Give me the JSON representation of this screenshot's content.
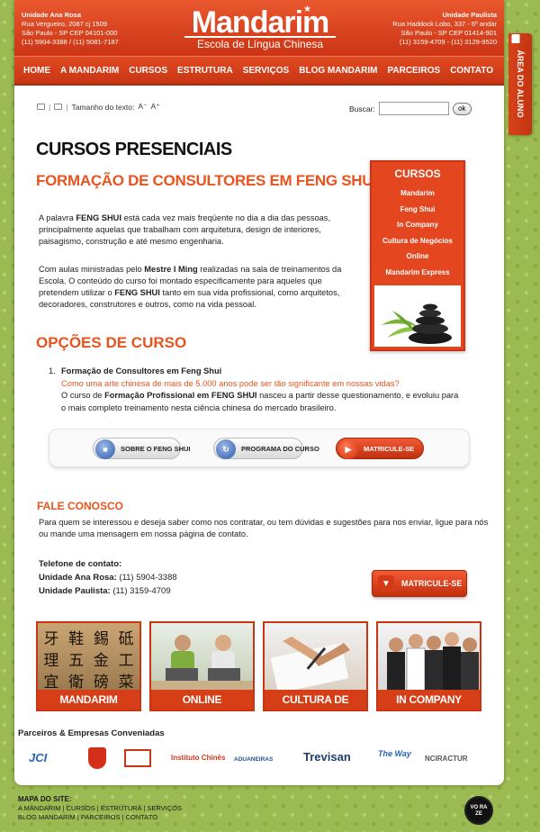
{
  "header": {
    "left": {
      "name": "Unidade Ana Rosa",
      "address1": "Rua Vergueiro, 2087 cj 1509",
      "address2": "São Paulo - SP CEP 04101-000",
      "phones": "(11) 5904-3388 / (11) 5081-7187"
    },
    "right": {
      "name": "Unidade Paulista",
      "address1": "Rua Haddock Lobo, 337 - 6º andar",
      "address2": "São Paulo - SP CEP 01414-901",
      "phones": "(11) 3159-4709 - (11) 3129-9520"
    },
    "logo": {
      "main": "Mandarim",
      "sub": "Escola de Língua Chinesa"
    }
  },
  "nav": [
    "HOME",
    "A MANDARIM",
    "CURSOS",
    "ESTRUTURA",
    "SERVIÇOS",
    "BLOG MANDARIM",
    "PARCEIROS",
    "CONTATO"
  ],
  "student_tab": "ÁREA DO ALUNO",
  "tools": {
    "text_size_label": "Tamanho do texto:",
    "decrease": "A⁻",
    "increase": "A⁺"
  },
  "search": {
    "label": "Buscar:",
    "value": "",
    "button": "ok"
  },
  "section_title": "CURSOS PRESENCIAIS",
  "course_title": "FORMAÇÃO DE CONSULTORES EM FENG SHUI",
  "para1": {
    "a": "A palavra ",
    "b": "FENG SHUI",
    "c": " está cada vez mais freqüente no dia a dia das pessoas, principalmente aquelas que trabalham com arquitetura, design de interiores, paisagismo, construção e até mesmo engenharia."
  },
  "para2": {
    "a": "Com aulas ministradas pelo ",
    "b": "Mestre I Ming",
    "c": " realizadas na sala de treinamentos da Escola. O conteúdo do curso foi montado especificamente para aqueles que pretendem utilizar o ",
    "d": "FENG SHUI",
    "e": " tanto em sua vida profissional, como arquitetos, decoradores, construtores e outros, como na vida pessoal."
  },
  "options_title": "OPÇÕES DE CURSO",
  "option1": {
    "num": "1.",
    "title": "Formação de Consultores em Feng Shui",
    "question": "Como uma arte chinesa de mais de 5.000 anos pode ser tão significante em nossas vidas?",
    "a": "O curso de ",
    "b": "Formação Profissional em FENG SHUI",
    "c": " nasceu a partir desse questionamento, e evoluiu para o mais completo treinamento nesta ciência chinesa do mercado brasileiro."
  },
  "buttons": {
    "about": "SOBRE O FENG SHUI",
    "program": "PROGRAMA DO CURSO",
    "enroll": "MATRICULE-SE"
  },
  "sidebar": {
    "title": "CURSOS",
    "items": [
      "Mandarim",
      "Feng Shui",
      "In Company",
      "Cultura de Negócios",
      "Online",
      "Mandarim Express"
    ]
  },
  "contact": {
    "title": "FALE CONOSCO",
    "text": "Para quem se interessou e deseja saber como nos contratar, ou tem dúvidas e sugestões para nos enviar, ligue para nós ou mande uma mensagem em nossa página de contato.",
    "tel_label": "Telefone de contato:",
    "unit1_label": "Unidade Ana Rosa:",
    "unit1_phone": " (11) 5904-3388",
    "unit2_label": "Unidade Paulista:",
    "unit2_phone": " (11) 3159-4709",
    "enroll": "MATRICULE-SE"
  },
  "tiles": [
    "MANDARIM",
    "ONLINE",
    "CULTURA DE NEGÓCIOS",
    "IN COMPANY"
  ],
  "tile1_chars": "牙 鞋 錫 砥 理 五 金 工 宜 衛 磅 菜",
  "partners_title": "Parceiros & Empresas Conveniadas",
  "partners": [
    "JCI",
    "Instituto Chinês",
    "ADUANEIRAS",
    "Trevisan",
    "The Way",
    "NCIRACTUR"
  ],
  "footer": {
    "title": "MAPA DO SITE:",
    "line1": "A MANDARIM | CURSOS | ESTRUTURA | SERVIÇOS",
    "line2": "BLOG MANDARIM | PARCEIROS | CONTATO"
  },
  "voraz": "VO RA ZE",
  "colors": {
    "accent": "#e8541f",
    "nav": "#d63e17",
    "background": "#9cba52"
  }
}
